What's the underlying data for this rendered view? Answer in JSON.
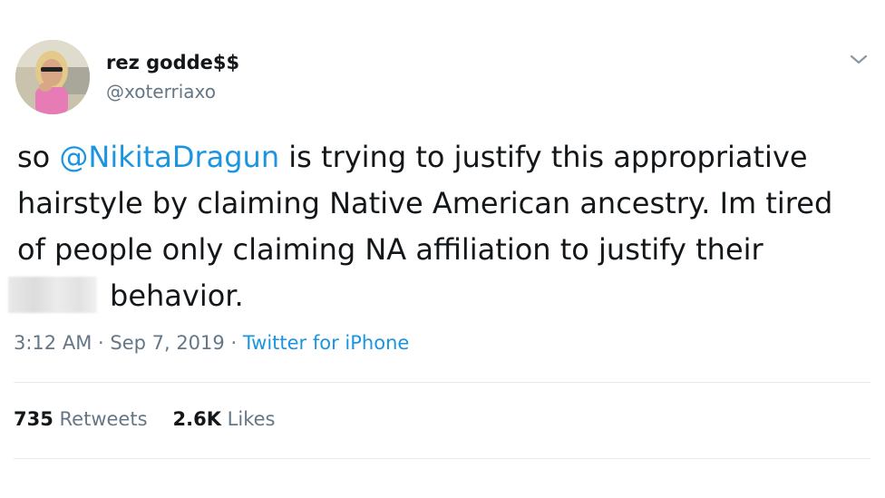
{
  "user": {
    "display_name": "rez godde$$",
    "handle": "@xoterriaxo"
  },
  "tweet": {
    "text_lead": "so ",
    "mention": "@NikitaDragun",
    "text_line1_rest": " is trying to justify this appropriative",
    "text_line2": "hairstyle by claiming Native American ancestry. Im tired",
    "text_line3": "of people only claiming NA affiliation to justify their",
    "text_line4_rest": "behavior."
  },
  "meta": {
    "time": "3:12 AM",
    "separator": " · ",
    "date": "Sep 7, 2019",
    "source": "Twitter for iPhone"
  },
  "stats": {
    "retweets_count": "735",
    "retweets_label": " Retweets",
    "likes_count": "2.6K",
    "likes_label": " Likes"
  },
  "colors": {
    "link": "#1b95e0",
    "secondary_text": "#657786",
    "primary_text": "#14171a",
    "divider": "#e6ecf0"
  },
  "icons": {
    "caret": "chevron-down-icon"
  }
}
